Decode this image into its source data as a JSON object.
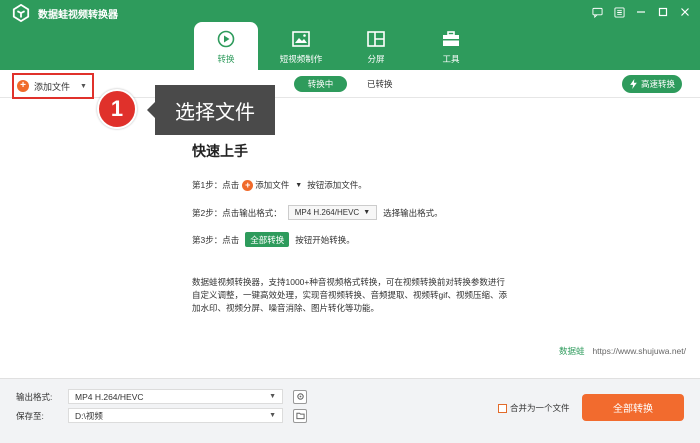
{
  "app": {
    "title": "数据蛙视频转换器"
  },
  "tabs": [
    {
      "label": "转换",
      "icon": "convert-icon"
    },
    {
      "label": "短视频制作",
      "icon": "video-maker-icon"
    },
    {
      "label": "分屏",
      "icon": "split-screen-icon"
    },
    {
      "label": "工具",
      "icon": "toolbox-icon"
    }
  ],
  "toolbar": {
    "add_file_label": "添加文件",
    "segment_converting": "转换中",
    "segment_converted": "已转换",
    "fast_convert_label": "高速转换"
  },
  "annotation": {
    "badge_number": "1",
    "tooltip_text": "选择文件"
  },
  "quickstart": {
    "title": "快速上手",
    "step1_prefix": "第1步：点击",
    "step1_add": "添加文件",
    "step1_suffix": "按钮添加文件。",
    "step2_prefix": "第2步：点击输出格式：",
    "step2_format": "MP4 H.264/HEVC",
    "step2_suffix": "选择输出格式。",
    "step3_prefix": "第3步：点击",
    "step3_button": "全部转换",
    "step3_suffix": "按钮开始转换。",
    "description": "数据蛙视频转换器，支持1000+种音视频格式转换，可在视频转换前对转换参数进行自定义调整，一键高效处理，实现音视频转换、音频提取、视频转gif、视频压缩、添加水印、视频分屏、噪音消除、图片转化等功能。",
    "site_brand": "数据蛙",
    "site_url": "https://www.shujuwa.net/"
  },
  "footer": {
    "output_format_label": "输出格式:",
    "output_format_value": "MP4 H.264/HEVC",
    "save_to_label": "保存至:",
    "save_to_value": "D:\\视频",
    "merge_label": "合并为一个文件",
    "merge_checked": false,
    "convert_all_label": "全部转换"
  },
  "colors": {
    "brand_green": "#2e9b5c",
    "accent_orange": "#f26b2e",
    "highlight_red": "#e0312b"
  }
}
